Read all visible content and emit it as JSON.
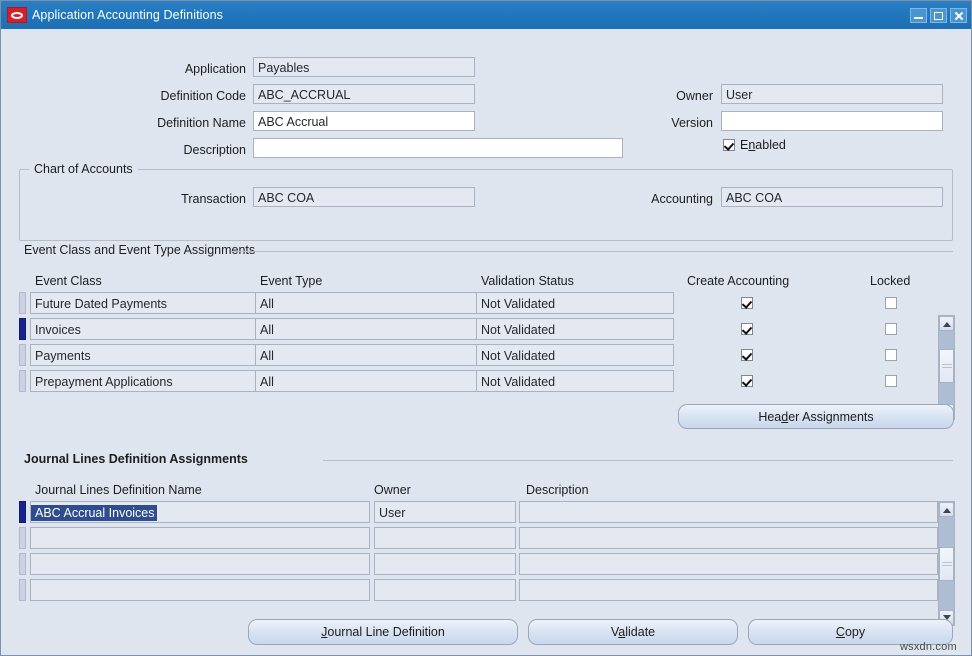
{
  "window": {
    "title": "Application Accounting Definitions",
    "logo_icon": "oracle-logo-icon",
    "minimize_label": "minimize-icon",
    "maximize_label": "maximize-icon",
    "close_label": "close-icon"
  },
  "header": {
    "application_label": "Application",
    "application_value": "Payables",
    "definition_code_label": "Definition Code",
    "definition_code_value": "ABC_ACCRUAL",
    "definition_name_label": "Definition Name",
    "definition_name_value": "ABC Accrual",
    "description_label": "Description",
    "description_value": "",
    "owner_label": "Owner",
    "owner_value": "User",
    "version_label": "Version",
    "version_value": "",
    "enabled_label_pre": "E",
    "enabled_label_mn": "n",
    "enabled_label_post": "abled",
    "enabled_checked": true
  },
  "chart_of_accounts": {
    "title": "Chart of Accounts",
    "transaction_label": "Transaction",
    "transaction_value": "ABC COA",
    "accounting_label": "Accounting",
    "accounting_value": "ABC COA"
  },
  "event_section": {
    "title": "Event Class and Event Type Assignments",
    "columns": [
      "Event Class",
      "Event Type",
      "Validation Status",
      "Create Accounting",
      "Locked"
    ],
    "rows": [
      {
        "event_class": "Future Dated Payments",
        "event_type": "All",
        "validation_status": "Not Validated",
        "create_accounting": true,
        "locked": false,
        "current": false
      },
      {
        "event_class": "Invoices",
        "event_type": "All",
        "validation_status": "Not Validated",
        "create_accounting": true,
        "locked": false,
        "current": true
      },
      {
        "event_class": "Payments",
        "event_type": "All",
        "validation_status": "Not Validated",
        "create_accounting": true,
        "locked": false,
        "current": false
      },
      {
        "event_class": "Prepayment Applications",
        "event_type": "All",
        "validation_status": "Not Validated",
        "create_accounting": true,
        "locked": false,
        "current": false
      }
    ],
    "header_assignments_pre": "Hea",
    "header_assignments_mn": "d",
    "header_assignments_post": "er Assignments"
  },
  "journal_section": {
    "title": "Journal Lines Definition Assignments",
    "columns": [
      "Journal Lines Definition Name",
      "Owner",
      "Description"
    ],
    "rows": [
      {
        "name": "ABC Accrual Invoices",
        "owner": "User",
        "description": "",
        "current": true,
        "name_selected": true
      },
      {
        "name": "",
        "owner": "",
        "description": "",
        "current": false,
        "name_selected": false
      },
      {
        "name": "",
        "owner": "",
        "description": "",
        "current": false,
        "name_selected": false
      },
      {
        "name": "",
        "owner": "",
        "description": "",
        "current": false,
        "name_selected": false
      }
    ]
  },
  "footer": {
    "buttons": [
      {
        "pre": "",
        "mn": "J",
        "post": "ournal Line Definition"
      },
      {
        "pre": "V",
        "mn": "a",
        "post": "lidate"
      },
      {
        "pre": "",
        "mn": "C",
        "post": "opy"
      }
    ]
  },
  "watermark": "wsxdn.com"
}
